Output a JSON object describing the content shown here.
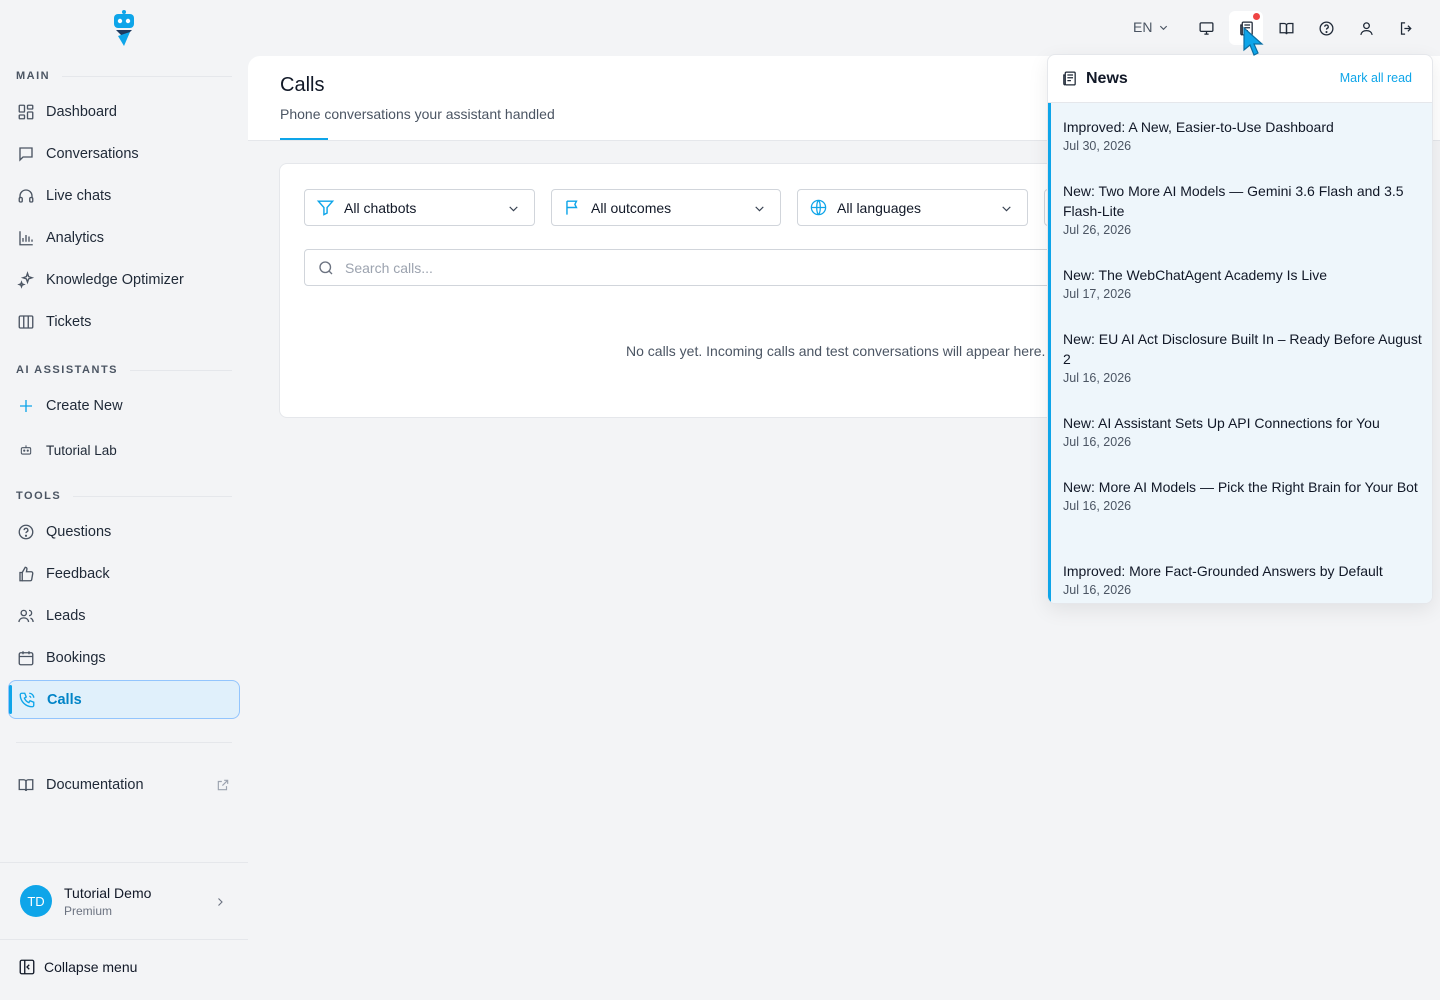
{
  "sidebar": {
    "sections": {
      "main": "MAIN",
      "assistants": "AI ASSISTANTS",
      "tools": "TOOLS"
    },
    "main_items": [
      {
        "label": "Dashboard",
        "icon": "dashboard-icon"
      },
      {
        "label": "Conversations",
        "icon": "chat-icon"
      },
      {
        "label": "Live chats",
        "icon": "headset-icon"
      },
      {
        "label": "Analytics",
        "icon": "bar-chart-icon"
      },
      {
        "label": "Knowledge Optimizer",
        "icon": "sparkle-icon"
      },
      {
        "label": "Tickets",
        "icon": "columns-icon"
      }
    ],
    "assistant_items": [
      {
        "label": "Create New",
        "icon": "plus-icon"
      },
      {
        "label": "Tutorial Lab",
        "icon": "bot-icon"
      }
    ],
    "tool_items": [
      {
        "label": "Questions",
        "icon": "question-icon"
      },
      {
        "label": "Feedback",
        "icon": "thumbs-up-icon"
      },
      {
        "label": "Leads",
        "icon": "users-icon"
      },
      {
        "label": "Bookings",
        "icon": "calendar-icon"
      },
      {
        "label": "Calls",
        "icon": "phone-icon",
        "active": true
      }
    ],
    "documentation": "Documentation",
    "user": {
      "initials": "TD",
      "name": "Tutorial Demo",
      "plan": "Premium"
    },
    "collapse": "Collapse menu"
  },
  "topbar": {
    "language": "EN",
    "icons": [
      "monitor-icon",
      "news-icon",
      "book-icon",
      "help-icon",
      "user-icon",
      "logout-icon"
    ],
    "news_notification_color": "#ef4444"
  },
  "page": {
    "title": "Calls",
    "subtitle": "Phone conversations your assistant handled"
  },
  "filters": {
    "chatbots": "All chatbots",
    "outcomes": "All outcomes",
    "languages": "All languages"
  },
  "search": {
    "placeholder": "Search calls..."
  },
  "empty_message": "No calls yet. Incoming calls and test conversations will appear here.",
  "news": {
    "title": "News",
    "mark_all_read": "Mark all read",
    "items": [
      {
        "title": "Improved: A New, Easier-to-Use Dashboard",
        "date": "Jul 30, 2026"
      },
      {
        "title": "New: Two More AI Models — Gemini 3.6 Flash and 3.5 Flash-Lite",
        "date": "Jul 26, 2026"
      },
      {
        "title": "New: The WebChatAgent Academy Is Live",
        "date": "Jul 17, 2026"
      },
      {
        "title": "New: EU AI Act Disclosure Built In – Ready Before August 2",
        "date": "Jul 16, 2026"
      },
      {
        "title": "New: AI Assistant Sets Up API Connections for You",
        "date": "Jul 16, 2026"
      },
      {
        "title": "New: More AI Models — Pick the Right Brain for Your Bot",
        "date": "Jul 16, 2026"
      },
      {
        "title": "Improved: More Fact-Grounded Answers by Default",
        "date": "Jul 16, 2026"
      }
    ]
  },
  "colors": {
    "accent": "#0ea5e9",
    "active_bg": "#e0f0fb",
    "unread_bg": "#eef6fb"
  }
}
